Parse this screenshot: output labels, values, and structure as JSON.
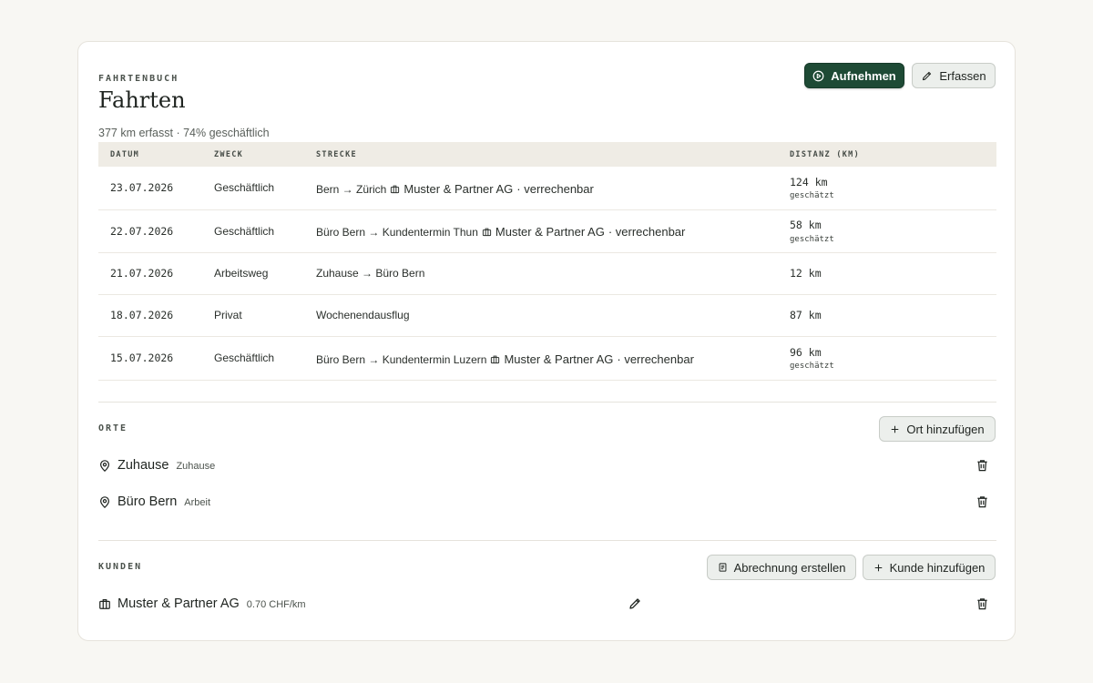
{
  "header": {
    "eyebrow": "FAHRTENBUCH",
    "title": "Fahrten",
    "summary": "377 km erfasst · 74% geschäftlich",
    "record_label": "Aufnehmen",
    "capture_label": "Erfassen"
  },
  "table": {
    "columns": [
      "DATUM",
      "ZWECK",
      "STRECKE",
      "DISTANZ (KM)"
    ],
    "rows": [
      {
        "date": "23.07.2026",
        "purpose": "Geschäftlich",
        "route": "Bern → Zürich",
        "client": "Muster & Partner AG",
        "billing": "· verrechenbar",
        "distance": "124 km",
        "note": "geschätzt"
      },
      {
        "date": "22.07.2026",
        "purpose": "Geschäftlich",
        "route": "Büro Bern → Kundentermin Thun",
        "client": "Muster & Partner AG",
        "billing": "· verrechenbar",
        "distance": "58 km",
        "note": "geschätzt"
      },
      {
        "date": "21.07.2026",
        "purpose": "Arbeitsweg",
        "route": "Zuhause → Büro Bern",
        "distance": "12 km"
      },
      {
        "date": "18.07.2026",
        "purpose": "Privat",
        "route": "Wochenendausflug",
        "distance": "87 km"
      },
      {
        "date": "15.07.2026",
        "purpose": "Geschäftlich",
        "route": "Büro Bern → Kundentermin Luzern",
        "client": "Muster & Partner AG",
        "billing": "· verrechenbar",
        "distance": "96 km",
        "note": "geschätzt"
      }
    ]
  },
  "places": {
    "eyebrow": "ORTE",
    "add_label": "Ort hinzufügen",
    "items": [
      {
        "name": "Zuhause",
        "tag": "Zuhause"
      },
      {
        "name": "Büro Bern",
        "tag": "Arbeit"
      }
    ]
  },
  "clients": {
    "eyebrow": "KUNDEN",
    "invoice_label": "Abrechnung erstellen",
    "add_label": "Kunde hinzufügen",
    "items": [
      {
        "name": "Muster & Partner AG",
        "rate": "0.70 CHF/km"
      }
    ]
  },
  "colors": {
    "accent": "#1e4a35",
    "header_bg": "#efece5",
    "page_bg": "#f8f7f3"
  },
  "icons": {
    "record": "play-circle-icon",
    "capture": "pencil-icon",
    "place": "map-pin-icon",
    "client": "briefcase-icon",
    "delete": "trash-icon",
    "add": "plus-icon",
    "invoice": "receipt-icon",
    "edit": "pencil-icon"
  }
}
